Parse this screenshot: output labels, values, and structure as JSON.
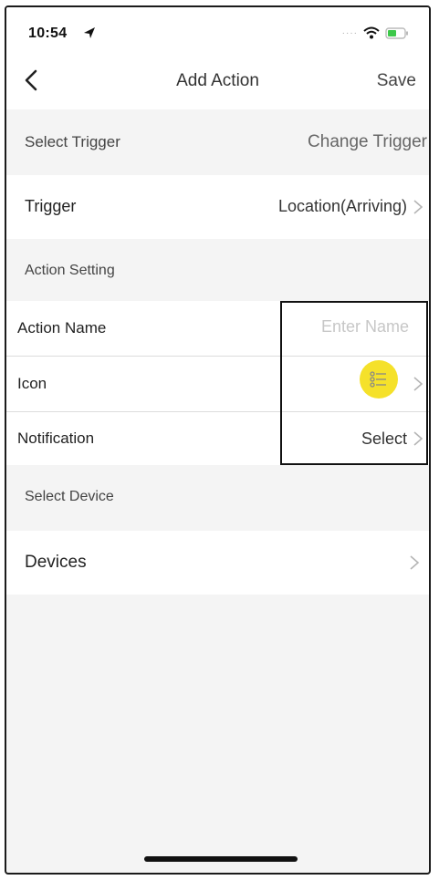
{
  "status_bar": {
    "time": "10:54"
  },
  "nav": {
    "title": "Add Action",
    "save_label": "Save"
  },
  "select_trigger": {
    "label": "Select Trigger",
    "action": "Change Trigger"
  },
  "trigger_row": {
    "label": "Trigger",
    "value": "Location(Arriving)"
  },
  "action_setting": {
    "header": "Action Setting",
    "action_name_label": "Action Name",
    "action_name_placeholder": "Enter Name",
    "icon_label": "Icon",
    "notification_label": "Notification",
    "notification_value": "Select"
  },
  "select_device": {
    "header": "Select Device",
    "devices_label": "Devices"
  },
  "colors": {
    "icon_highlight": "#f5e12a",
    "background": "#f4f4f4"
  }
}
